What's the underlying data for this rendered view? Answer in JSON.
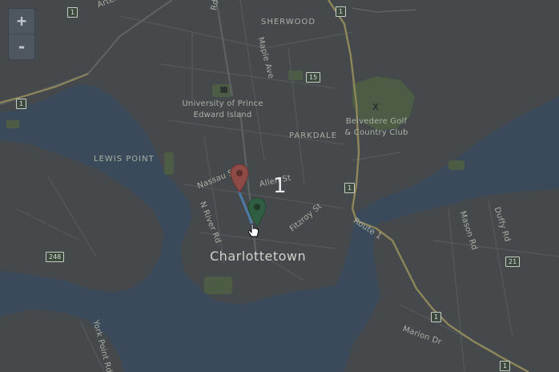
{
  "map": {
    "zoom_in_label": "+",
    "zoom_out_label": "-",
    "cluster_count": "1",
    "city": "Charlottetown",
    "places": {
      "sherwood": "SHERWOOD",
      "parkdale": "PARKDALE",
      "lewis_point": "LEWIS POINT",
      "university_line1": "University of Prince",
      "university_line2": "Edward Island",
      "golf_line1": "Belvedere Golf",
      "golf_line2": "& Country Club"
    },
    "streets": {
      "arterial": "Arterial Hwy",
      "rd_top": "Rd",
      "maple": "Maple Ave",
      "nassau": "Nassau St",
      "allen": "Allen St",
      "n_river": "N River Rd",
      "fitzroy": "Fitzroy St",
      "route1": "Route 1",
      "mason": "Mason Rd",
      "duffy": "Duffy Rd",
      "marion": "Marion Dr",
      "york_point": "York Point Rd"
    },
    "shields": {
      "s1a": "1",
      "s1b": "1",
      "s1c": "1",
      "s1d": "1",
      "s1e": "1",
      "s15": "15",
      "s248": "248",
      "s21": "21"
    },
    "markers": [
      {
        "name": "red-marker",
        "color": "#8e4a45"
      },
      {
        "name": "green-marker",
        "color": "#2f5e43"
      }
    ],
    "colors": {
      "water": "#3a4a5a",
      "land": "#45494c",
      "park": "#4d5c45",
      "road": "#565b5e",
      "route": "#a89d63",
      "label": "#a9b1a4"
    }
  }
}
